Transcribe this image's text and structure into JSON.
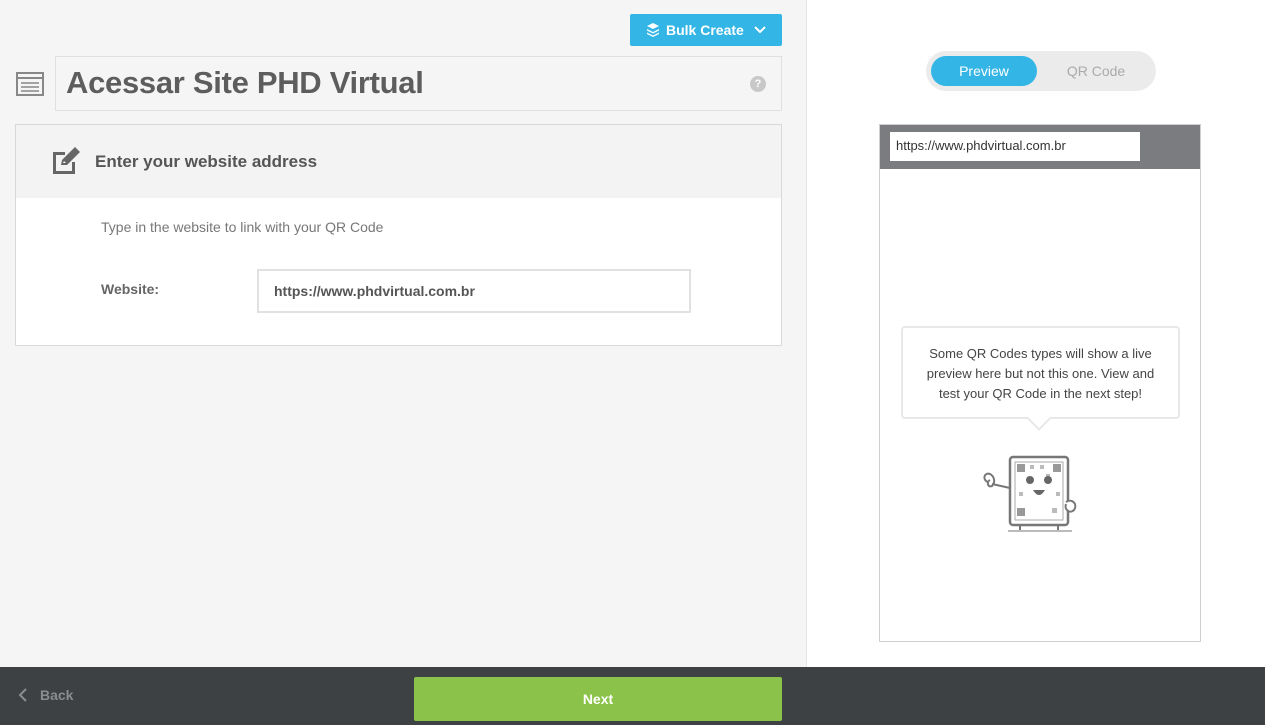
{
  "toolbar": {
    "bulk_create_label": "Bulk Create",
    "accent_color": "#33b5e5"
  },
  "header": {
    "title": "Acessar Site PHD Virtual",
    "help_glyph": "?"
  },
  "card": {
    "title": "Enter your website address",
    "description": "Type in the website to link with your QR Code",
    "website_label": "Website:",
    "website_value": "https://www.phdvirtual.com.br"
  },
  "preview_panel": {
    "tabs": [
      {
        "label": "Preview",
        "active": true
      },
      {
        "label": "QR Code",
        "active": false
      }
    ],
    "url_bar_value": "https://www.phdvirtual.com.br",
    "bubble_text": "Some QR Codes types will show a live preview here but not this one. View and test your QR Code in the next step!"
  },
  "footer": {
    "back_label": "Back",
    "next_label": "Next",
    "next_color": "#8bc34a"
  }
}
